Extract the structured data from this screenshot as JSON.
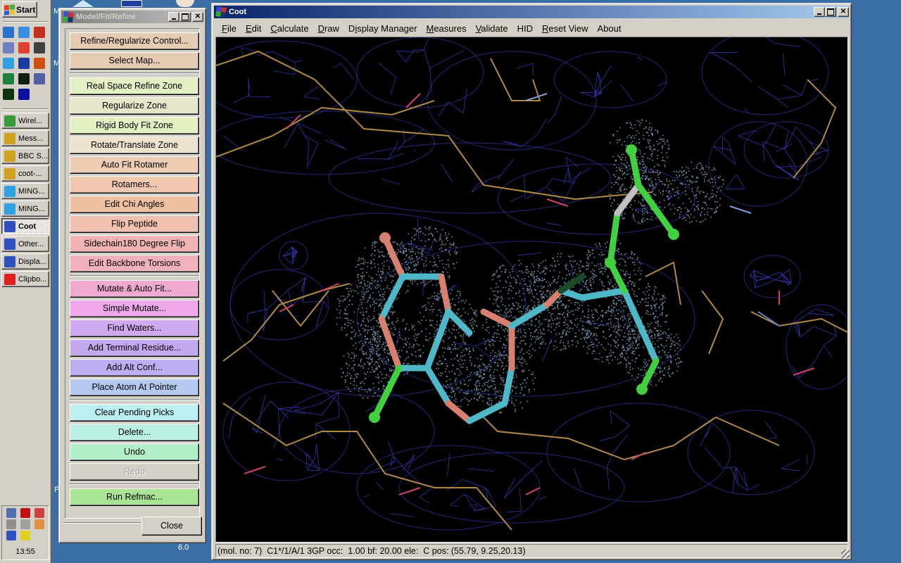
{
  "taskbar": {
    "start_label": "Start",
    "quick_launch": [
      {
        "icon": "outlook-express-icon",
        "color": "#2a72d0"
      },
      {
        "icon": "internet-explorer-icon",
        "color": "#3a8ee0"
      },
      {
        "icon": "dragon-app-icon",
        "color": "#c03020"
      },
      {
        "icon": "notepad-window-icon",
        "color": "#7080c0"
      },
      {
        "icon": "no-entry-app-icon",
        "color": "#e04030"
      },
      {
        "icon": "bird-app-icon",
        "color": "#404040"
      },
      {
        "icon": "ming-app-icon",
        "color": "#30a0e0"
      },
      {
        "icon": "word-icon",
        "color": "#1a3aa0"
      },
      {
        "icon": "powerpoint-icon",
        "color": "#d05010"
      },
      {
        "icon": "excel-icon",
        "color": "#208040"
      },
      {
        "icon": "molecule-app-icon",
        "color": "#102010"
      },
      {
        "icon": "network-app-icon",
        "color": "#5060a0"
      },
      {
        "icon": "plug-app-icon",
        "color": "#103010"
      },
      {
        "icon": "diamond-app-icon",
        "color": "#1010a0"
      }
    ],
    "tasks": [
      {
        "label": "Wirel...",
        "icon": "wireless-icon",
        "color": "#3a9a3a",
        "active": false
      },
      {
        "label": "Mess...",
        "icon": "messenger-icon",
        "color": "#d0a020",
        "active": false
      },
      {
        "label": "BBC S...",
        "icon": "bbc-icon",
        "color": "#d0a020",
        "active": false
      },
      {
        "label": "coot-...",
        "icon": "coot-console-icon",
        "color": "#d0a020",
        "active": false
      },
      {
        "label": "MING...",
        "icon": "ming-icon",
        "color": "#30a0e0",
        "active": false
      },
      {
        "label": "MING...",
        "icon": "ming-icon",
        "color": "#30a0e0",
        "active": false
      },
      {
        "label": "Coot",
        "icon": "coot-icon",
        "color": "#3050c0",
        "active": true
      },
      {
        "label": "Other...",
        "icon": "coot-icon",
        "color": "#3050c0",
        "active": false
      },
      {
        "label": "Displa...",
        "icon": "coot-icon",
        "color": "#3050c0",
        "active": false
      },
      {
        "label": "Clipbo...",
        "icon": "clipboard-icon",
        "color": "#e02020",
        "active": false
      }
    ],
    "tray_icons": [
      {
        "icon": "network-tray-icon",
        "color": "#5070b0"
      },
      {
        "icon": "security-tray-icon",
        "color": "#c01010"
      },
      {
        "icon": "network-disconnected-icon",
        "color": "#d04040"
      },
      {
        "icon": "blocked-tray-icon",
        "color": "#909090"
      },
      {
        "icon": "mouse-tray-icon",
        "color": "#a0a0a0"
      },
      {
        "icon": "hand-tray-icon",
        "color": "#e09040"
      },
      {
        "icon": "card-tray-icon",
        "color": "#3050c0"
      },
      {
        "icon": "shield-tray-icon",
        "color": "#e0d020"
      }
    ],
    "clock": "13:55"
  },
  "desktop": {
    "labels": [
      "M",
      "M",
      "P",
      "6.0"
    ]
  },
  "model_fit_refine": {
    "title": "Model/Fit/Refine",
    "groups": [
      [
        {
          "label": "Refine/Regularize Control...",
          "color": "#e6cbb3"
        },
        {
          "label": "Select Map...",
          "color": "#e6cbb3"
        }
      ],
      [
        {
          "label": "Real Space Refine Zone",
          "color": "#e2f0c2"
        },
        {
          "label": "Regularize Zone",
          "color": "#e8e6c8"
        },
        {
          "label": "Rigid Body Fit Zone",
          "color": "#e2f0c2"
        },
        {
          "label": "Rotate/Translate Zone",
          "color": "#ece2ce"
        },
        {
          "label": "Auto Fit Rotamer",
          "color": "#efcdb4"
        },
        {
          "label": "Rotamers...",
          "color": "#f2c7b0"
        },
        {
          "label": "Edit Chi Angles",
          "color": "#f0c0a2"
        },
        {
          "label": "Flip Peptide",
          "color": "#f2c0ae"
        },
        {
          "label": "Sidechain180 Degree Flip",
          "color": "#f0b4b4"
        },
        {
          "label": "Edit Backbone Torsions",
          "color": "#f0b0bc"
        }
      ],
      [
        {
          "label": "Mutate & Auto Fit...",
          "color": "#f0aad0"
        },
        {
          "label": "Simple Mutate...",
          "color": "#f0a8ec"
        },
        {
          "label": "Find Waters...",
          "color": "#d0aaf0"
        },
        {
          "label": "Add Terminal Residue...",
          "color": "#c4a8f0"
        },
        {
          "label": "Add Alt Conf...",
          "color": "#bcaef0"
        },
        {
          "label": "Place Atom At Pointer",
          "color": "#b4c8f0"
        }
      ],
      [
        {
          "label": "Clear Pending Picks",
          "color": "#bcf0f0"
        },
        {
          "label": "Delete...",
          "color": "#bcf0e4"
        },
        {
          "label": "Undo",
          "color": "#b0f0c8"
        },
        {
          "label": "Redo",
          "color": "#d4d0c8",
          "disabled": true
        }
      ],
      [
        {
          "label": "Run Refmac...",
          "color": "#a8e494"
        }
      ]
    ],
    "close_label": "Close"
  },
  "coot": {
    "title": "Coot",
    "menu": [
      {
        "label": "File",
        "mnemonic": "F"
      },
      {
        "label": "Edit",
        "mnemonic": "E"
      },
      {
        "label": "Calculate",
        "mnemonic": "C"
      },
      {
        "label": "Draw",
        "mnemonic": "D"
      },
      {
        "label": "Display Manager",
        "mnemonic": "i"
      },
      {
        "label": "Measures",
        "mnemonic": "M"
      },
      {
        "label": "Validate",
        "mnemonic": "V"
      },
      {
        "label": "HID",
        "mnemonic": ""
      },
      {
        "label": "Reset View",
        "mnemonic": "R"
      },
      {
        "label": "About",
        "mnemonic": ""
      }
    ],
    "status": "(mol. no: 7)  C1*/1/A/1 3GP occ:  1.00 bf: 20.00 ele:  C pos: (55.79, 9.25,20.13)",
    "viewport": {
      "background": "#000000",
      "map_mesh_color": "#3a3fc8",
      "dot_surface_color": "#7090a8",
      "carbon_color": "#4fb8c8",
      "oxygen_color": "#d88070",
      "nitrogen_color": "#40d040",
      "backbone_color": "#b08a40",
      "residue": "3GP"
    }
  }
}
